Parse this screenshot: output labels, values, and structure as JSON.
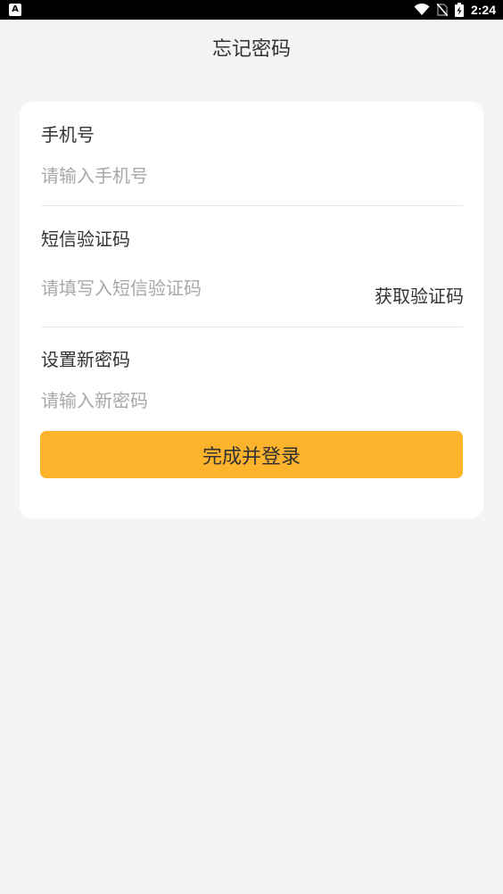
{
  "status_bar": {
    "left_icon_letter": "A",
    "time": "2:24"
  },
  "page": {
    "title": "忘记密码"
  },
  "form": {
    "phone": {
      "label": "手机号",
      "placeholder": "请输入手机号",
      "value": ""
    },
    "sms_code": {
      "label": "短信验证码",
      "placeholder": "请填写入短信验证码",
      "value": "",
      "get_code_label": "获取验证码"
    },
    "new_password": {
      "label": "设置新密码",
      "placeholder": "请输入新密码",
      "value": ""
    },
    "submit_label": "完成并登录"
  },
  "colors": {
    "accent": "#fdb32b",
    "background": "#f4f4f4",
    "card": "#ffffff"
  }
}
